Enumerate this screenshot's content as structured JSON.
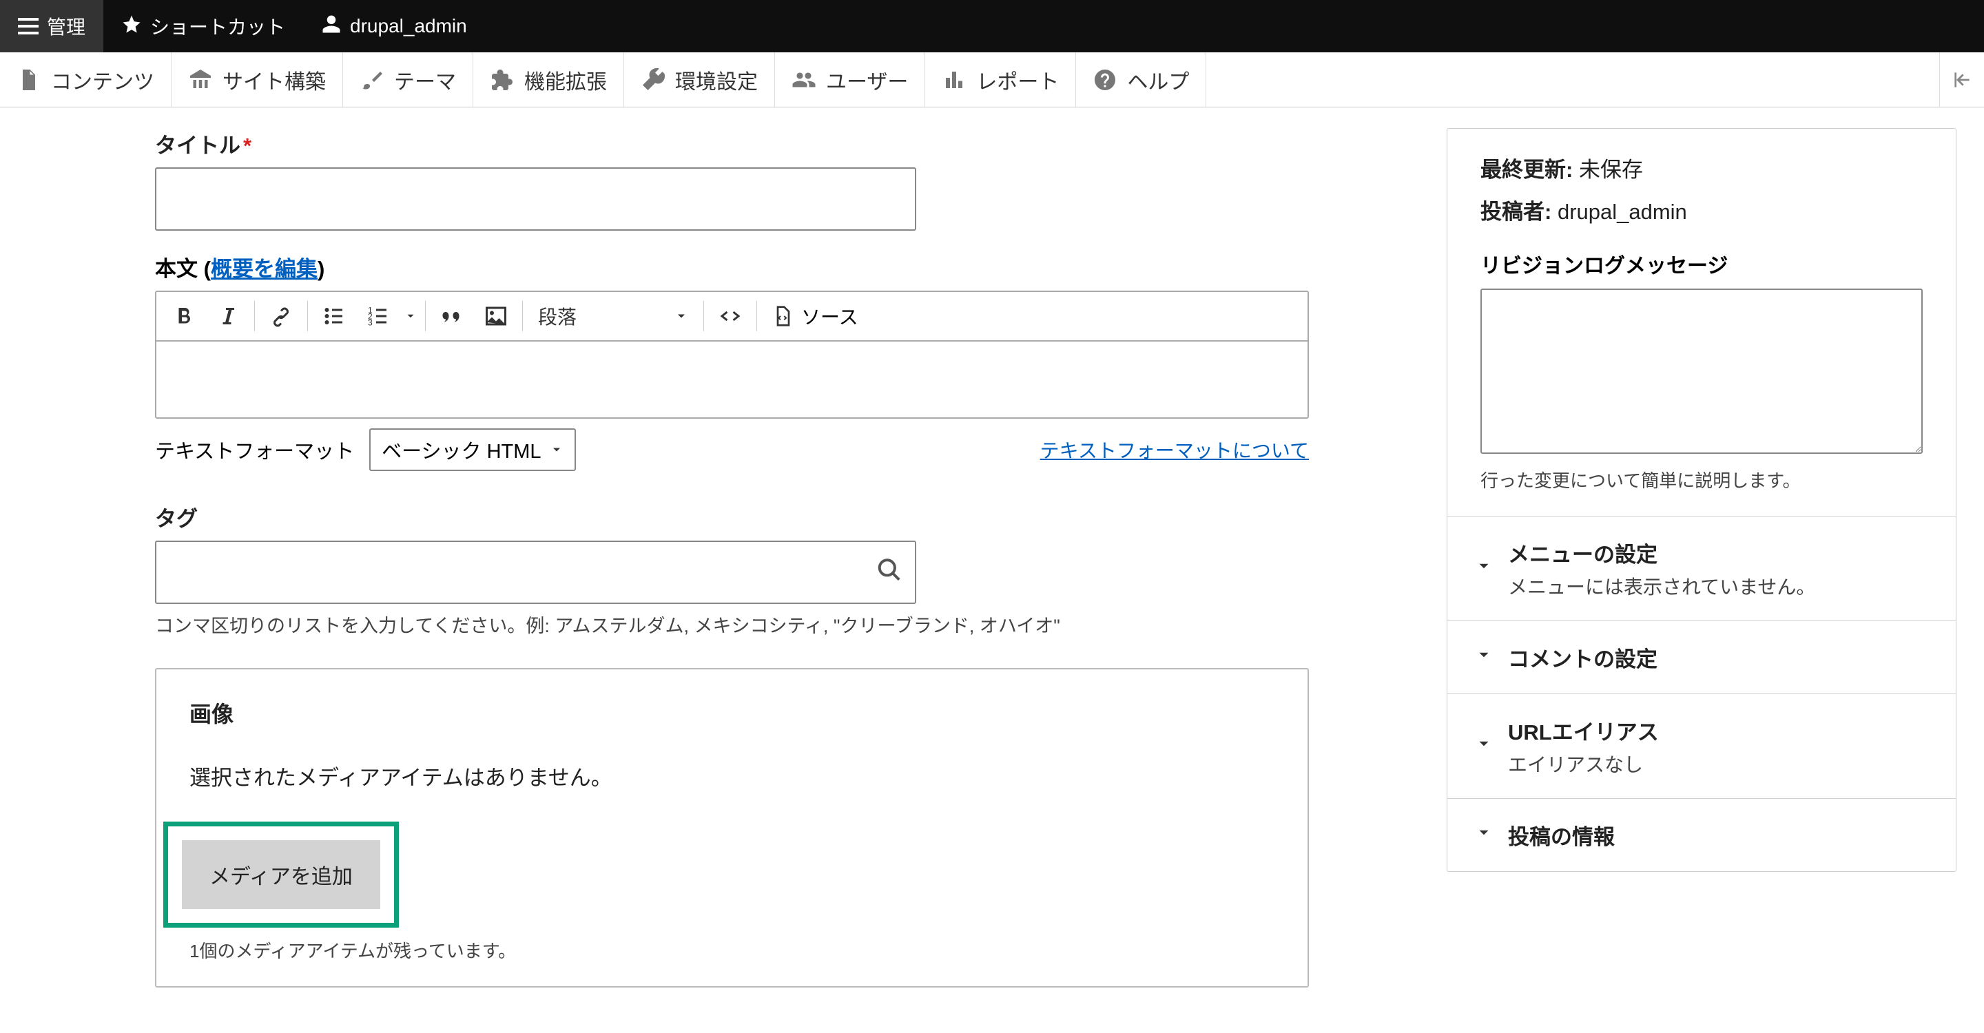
{
  "topbar": {
    "manage": "管理",
    "shortcuts": "ショートカット",
    "user": "drupal_admin"
  },
  "admin_menu": {
    "content": "コンテンツ",
    "structure": "サイト構築",
    "appearance": "テーマ",
    "extend": "機能拡張",
    "config": "環境設定",
    "people": "ユーザー",
    "reports": "レポート",
    "help": "ヘルプ"
  },
  "form": {
    "title_label": "タイトル",
    "body_label": "本文",
    "summary_link": "概要を編集",
    "paragraph_option": "段落",
    "source_label": "ソース",
    "text_format_label": "テキストフォーマット",
    "text_format_value": "ベーシック HTML",
    "text_format_help": "テキストフォーマットについて",
    "tags_label": "タグ",
    "tags_help": "コンマ区切りのリストを入力してください。例: アムステルダム, メキシコシティ, \"クリーブランド, オハイオ\"",
    "image_legend": "画像",
    "image_empty": "選択されたメディアアイテムはありません。",
    "add_media_btn": "メディアを追加",
    "media_remaining": "1個のメディアアイテムが残っています。"
  },
  "sidebar": {
    "last_saved_label": "最終更新:",
    "last_saved_value": "未保存",
    "author_label": "投稿者:",
    "author_value": "drupal_admin",
    "revlog_label": "リビジョンログメッセージ",
    "revlog_help": "行った変更について簡単に説明します。",
    "menu_title": "メニューの設定",
    "menu_sub": "メニューには表示されていません。",
    "comment_title": "コメントの設定",
    "url_title": "URLエイリアス",
    "url_sub": "エイリアスなし",
    "authoring_title": "投稿の情報"
  }
}
